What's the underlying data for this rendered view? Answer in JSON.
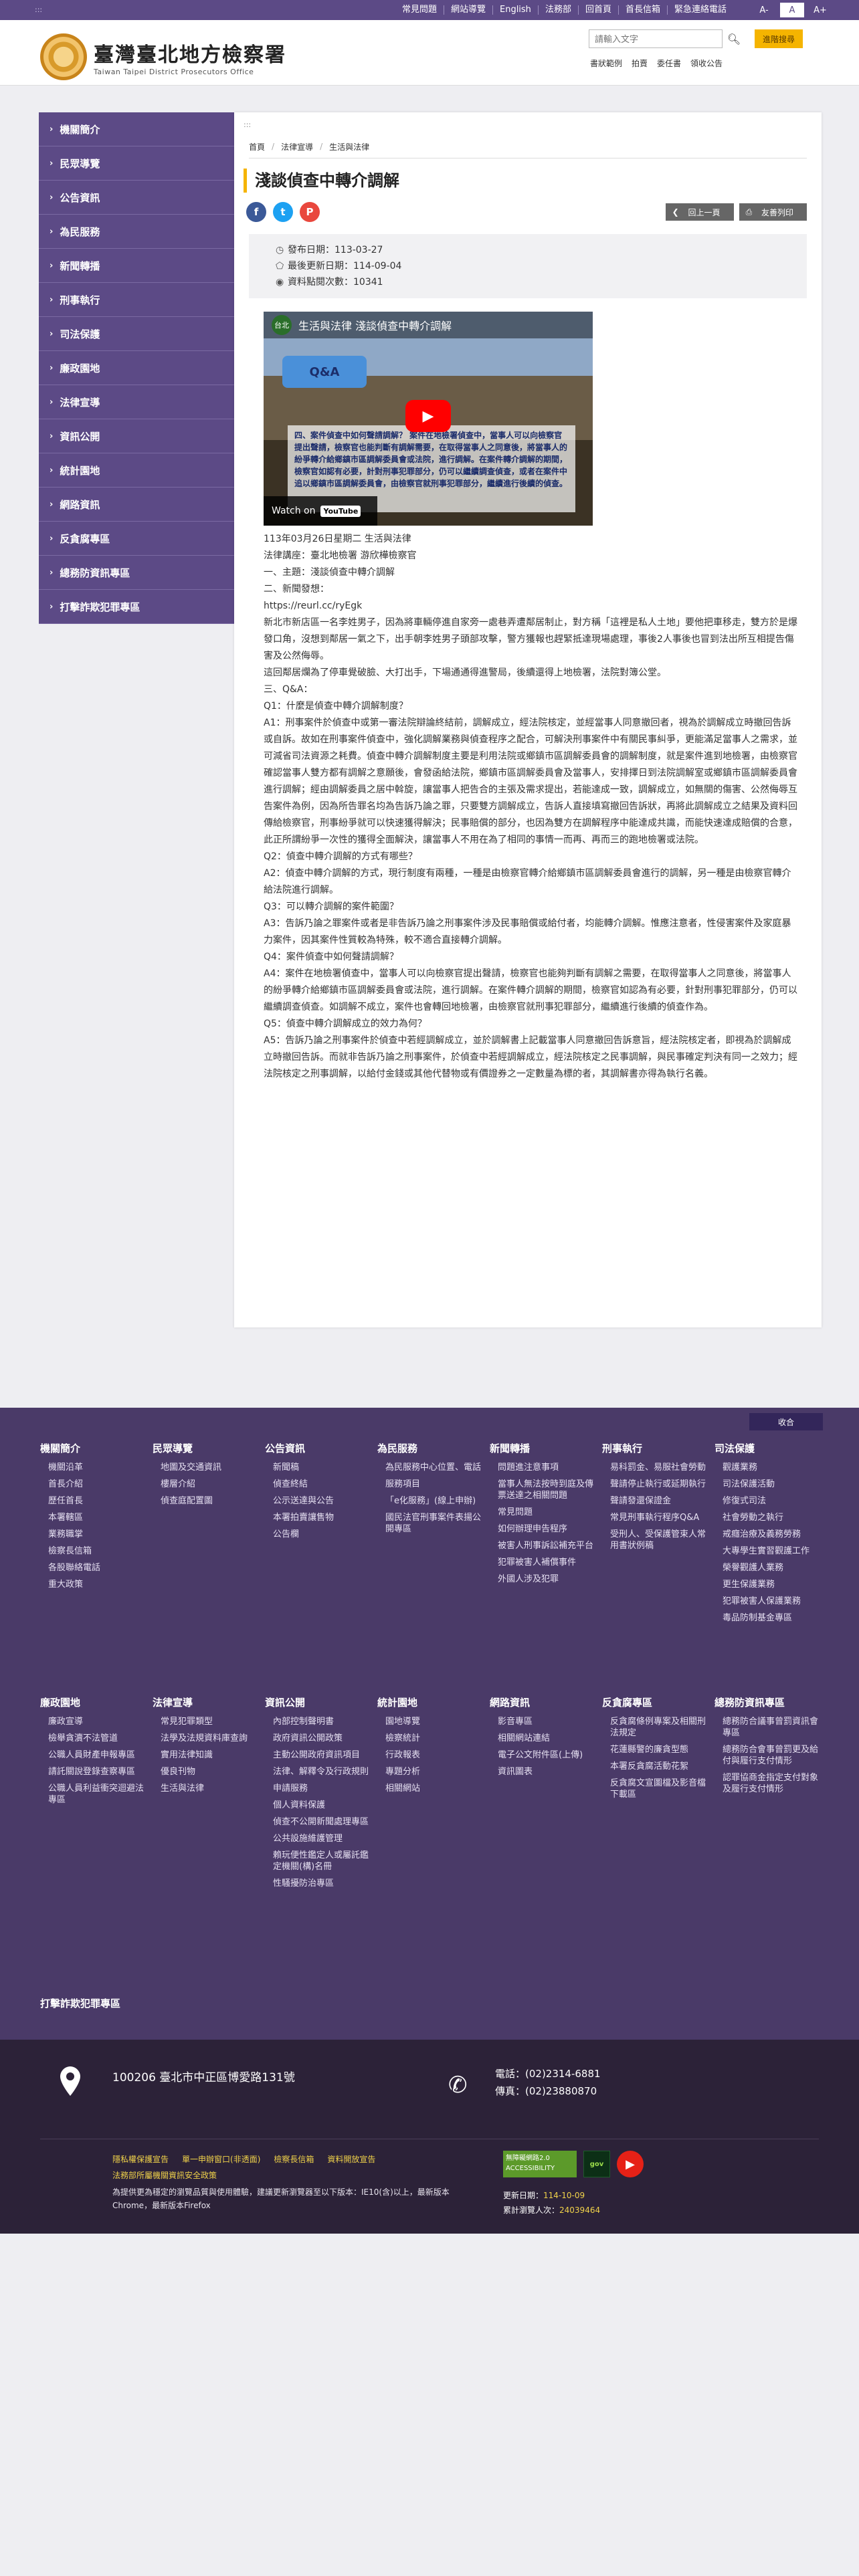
{
  "topbar": {
    "accesskey": ":::",
    "links": [
      "常見問題",
      "網站導覽",
      "English",
      "法務部",
      "回首頁",
      "首長信箱",
      "緊急連絡電話"
    ],
    "font_sizes": [
      "A-",
      "A",
      "A+"
    ]
  },
  "header": {
    "title": "臺灣臺北地方檢察署",
    "subtitle": "Taiwan Taipei District Prosecutors Office",
    "search_placeholder": "請輸入文字",
    "search_icon": "search-icon",
    "advanced_search": "進階搜尋",
    "hot_keywords": [
      "書狀範例",
      "拍賣",
      "委任書",
      "領收公告"
    ]
  },
  "sidebar": {
    "items": [
      "機關簡介",
      "民眾導覽",
      "公告資訊",
      "為民服務",
      "新聞轉播",
      "刑事執行",
      "司法保護",
      "廉政園地",
      "法律宣導",
      "資訊公開",
      "統計園地",
      "網路資訊",
      "反貪腐專區",
      "總務防資訊專區",
      "打擊詐欺犯罪專區"
    ]
  },
  "content": {
    "accesskey": ":::",
    "breadcrumb": [
      "首頁",
      "法律宣導",
      "生活與法律"
    ],
    "title": "淺談偵查中轉介調解",
    "share_icons": [
      "facebook-icon",
      "twitter-icon",
      "plurk-icon"
    ],
    "back_button": "回上一頁",
    "print_button": "友善列印",
    "publish_date": "發布日期：113-03-27",
    "update_date": "最後更新日期：114-09-04",
    "views": "資料點閱次數：10341",
    "video": {
      "channel_badge": "台北",
      "title": "生活與法律 淺談偵查中轉介調解",
      "qa_label": "Q&A",
      "caption": "四、案件偵查中如何聲請調解？ 案件在地檢署偵查中，當事人可以向檢察官提出聲請，檢察官也能判斷有調解需要，在取得當事人之同意後，將當事人的紛爭轉介給鄉鎮市區調解委員會或法院，進行調解。在案件轉介調解的期間，檢察官如認有必要，計對刑事犯罪部分，仍可以繼續調查偵查，或者在案件中追以鄉鎮市區調解委員會，由檢察官就刑事犯罪部分，繼續進行後續的偵查。",
      "watch_on": "Watch on",
      "youtube": "YouTube"
    },
    "paragraphs": [
      "113年03月26日星期二 生活與法律",
      "法律講座：臺北地檢署 游欣樺檢察官",
      "一、主題：淺談偵查中轉介調解",
      "二、新聞發想：",
      "https://reurl.cc/ryEgk",
      "新北市新店區一名李姓男子，因為將車輛停進自家旁一處巷弄遭鄰居制止，對方稱「這裡是私人土地」要他把車移走，雙方於是爆發口角，沒想到鄰居一氣之下，出手朝李姓男子頭部攻擊，警方獲報也趕緊抵達現場處理，事後2人事後也冒到法出所互相提告傷害及公然侮辱。",
      "這回鄰居爛為了停車覺破臉、大打出手，下場通通得進警局，後續還得上地檢署，法院對簿公堂。",
      "三、Q&A：",
      "Q1：什麼是偵查中轉介調解制度？",
      "A1：刑事案件於偵查中或第一審法院辯論終結前，調解成立，經法院核定，並經當事人同意撤回者，視為於調解成立時撤回告訴或自訴。故如在刑事案件偵查中，強化調解業務與偵查程序之配合，可解決刑事案件中有關民事糾爭，更能滿足當事人之需求，並可減省司法資源之耗費。偵查中轉介調解制度主要是利用法院或鄉鎮市區調解委員會的調解制度，就是案件進到地檢署，由檢察官確認當事人雙方都有調解之意願後，會發函給法院，鄉鎮市區調解委員會及當事人，安排擇日到法院調解室或鄉鎮市區調解委員會進行調解；經由調解委員之居中斡旋，讓當事人把告合的主張及需求提出，若能達成一致，調解成立，如無關的傷害、公然侮辱互告案件為例，因為所告罪名均為告訴乃論之罪，只要雙方調解成立，告訴人直接填寫撤回告訴狀，再將此調解成立之結果及資料回傳給檢察官，刑事紛爭就可以快速獲得解決；民事賠償的部分，也因為雙方在調解程序中能達成共識，而能快速達成賠償的合意，此正所謂紛爭一次性的獲得全面解決，讓當事人不用在為了相同的事情一而再、再而三的跑地檢署或法院。",
      "Q2：偵查中轉介調解的方式有哪些？",
      "A2：偵查中轉介調解的方式，現行制度有兩種，一種是由檢察官轉介給鄉鎮市區調解委員會進行的調解，另一種是由檢察官轉介給法院進行調解。",
      "Q3：可以轉介調解的案件範圍？",
      "A3：告訴乃論之罪案件或者是非告訴乃論之刑事案件涉及民事賠償或給付者，均能轉介調解。惟應注意者，性侵害案件及家庭暴力案件，因其案件性質較為特殊，較不適合直接轉介調解。",
      "Q4：案件偵查中如何聲請調解？",
      "A4：案件在地檢署偵查中，當事人可以向檢察官提出聲請，檢察官也能夠判斷有調解之需要，在取得當事人之同意後，將當事人的紛爭轉介給鄉鎮市區調解委員會或法院，進行調解。在案件轉介調解的期間，檢察官如認為有必要，針對刑事犯罪部分，仍可以繼續調查偵查。如調解不成立，案件也會轉回地檢署，由檢察官就刑事犯罪部分，繼續進行後續的偵查作為。",
      "Q5：偵查中轉介調解成立的效力為何？",
      "A5：告訴乃論之刑事案件於偵查中若經調解成立，並於調解書上記載當事人同意撤回告訴意旨，經法院核定者，即視為於調解成立時撤回告訴。而就非告訴乃論之刑事案件，於偵查中若經調解成立，經法院核定之民事調解，與民事確定判決有同一之效力；經法院核定之刑事調解，以給付金錢或其他代替物或有價證券之一定數量為標的者，其調解書亦得為執行名義。"
    ]
  },
  "footer": {
    "collapse_label": "收合",
    "columns": [
      {
        "title": "機關簡介",
        "links": [
          "機關沿革",
          "首長介紹",
          "歷任首長",
          "本署轄區",
          "業務職掌",
          "檢察長信箱",
          "各股聯絡電話",
          "重大政策"
        ]
      },
      {
        "title": "民眾導覽",
        "links": [
          "地圖及交通資訊",
          "樓層介紹",
          "偵查庭配置圖"
        ]
      },
      {
        "title": "公告資訊",
        "links": [
          "新聞稿",
          "偵查終結",
          "公示送達與公告",
          "本署拍賣讓售物",
          "公告欄"
        ]
      },
      {
        "title": "為民服務",
        "links": [
          "為民服務中心位置、電話",
          "服務項目",
          "「e化服務」(線上申辦)",
          "國民法官刑事案件表揚公開專區"
        ]
      },
      {
        "title": "新聞轉播",
        "links": [
          "問題進注意事項",
          "當事人無法按時到庭及傳票送達之相關問題",
          "常見問題",
          "如何辦理申告程序",
          "被害人刑事訴訟補充平台",
          "犯罪被害人補償事件",
          "外國人涉及犯罪"
        ]
      },
      {
        "title": "刑事執行",
        "links": [
          "易科罰金、易服社會勞動",
          "聲請停止執行或延期執行",
          "聲請發還保證金",
          "常見刑事執行程序Q&A",
          "受刑人、受保護管束人常用書狀例稿"
        ]
      },
      {
        "title": "司法保護",
        "links": [
          "觀護業務",
          "司法保護活動",
          "修復式司法",
          "社會勞動之執行",
          "戒癮治療及義務勞務",
          "大專學生實習觀護工作",
          "榮譽觀護人業務",
          "更生保護業務",
          "犯罪被害人保護業務",
          "毒品防制基金專區"
        ]
      },
      {
        "title": "廉政園地",
        "links": [
          "廉政宣導",
          "檢舉貪瀆不法管道",
          "公職人員財產申報專區",
          "請託關說登錄查察專區",
          "公職人員利益衝突迴避法專區"
        ]
      },
      {
        "title": "法律宣導",
        "links": [
          "常見犯罪類型",
          "法學及法規資料庫查詢",
          "實用法律知識",
          "優良刊物",
          "生活與法律"
        ]
      },
      {
        "title": "資訊公開",
        "links": [
          "內部控制聲明書",
          "政府資訊公開政策",
          "主動公開政府資訊項目",
          "法律、解釋令及行政規則",
          "申請服務",
          "個人資料保護",
          "偵查不公開新聞處理專區",
          "公共設施維護管理",
          "賴玩便性鑑定人或屬託鑑定機關(構)名冊",
          "性騷擾防治專區"
        ]
      },
      {
        "title": "統計園地",
        "links": [
          "園地導覽",
          "檢察統計",
          "行政報表",
          "專題分析",
          "相關網站"
        ]
      },
      {
        "title": "網路資訊",
        "links": [
          "影音專區",
          "相關網站連結",
          "電子公文附件區(上傳)",
          "資訊圖表"
        ]
      },
      {
        "title": "反貪腐專區",
        "links": [
          "反貪腐條例專案及相關刑法規定",
          "花蓮縣警的廉貪型態",
          "本署反貪腐活動花絮",
          "反貪腐文宣圖檔及影音檔下載區"
        ]
      },
      {
        "title": "總務防資訊專區",
        "links": [
          "總務防合議事曾罰資訊會專區",
          "總務防合會事曾罰更及給付與履行支付情形",
          "認罪協商金指定支付對象及履行支付情形"
        ]
      }
    ],
    "tail": "打擊詐欺犯罪專區"
  },
  "address": {
    "address": "100206 臺北市中正區博愛路131號",
    "phone": "電話：(02)2314-6881",
    "fax": "傳真：(02)23880870",
    "links": [
      "隱私權保護宣告",
      "單一申辦窗口(非透面)",
      "檢察長信箱",
      "資料開放宣告"
    ],
    "links2": "法務部所屬機關資訊安全政策",
    "note": "為提供更為穩定的瀏覽品質與使用體驗，建議更新瀏覽器至以下版本：IE10(含)以上，最新版本Chrome，最新版本Firefox",
    "accessibility_badge": "無障礙網路2.0 ACCESSIBILITY",
    "gov_badge": "gov",
    "update_label": "更新日期：",
    "update_value": "114-10-09",
    "visits_label": "累計瀏覽人次：",
    "visits_value": "24039464"
  }
}
